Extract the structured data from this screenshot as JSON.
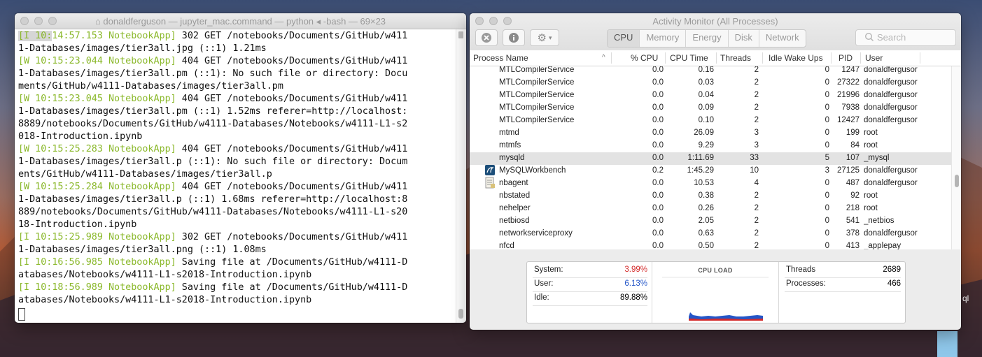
{
  "terminal": {
    "title": "donaldferguson — jupyter_mac.command — python ◂ -bash — 69×23",
    "lines": [
      {
        "tag": "[I 10:14:57.153 NotebookApp]",
        "text": " 302 GET /notebooks/Documents/GitHub/w411"
      },
      {
        "tag": "",
        "text": "1-Databases/images/tier3all.jpg (::1) 1.21ms"
      },
      {
        "tag": "[W 10:15:23.044 NotebookApp]",
        "text": " 404 GET /notebooks/Documents/GitHub/w411"
      },
      {
        "tag": "",
        "text": "1-Databases/images/tier3all.pm (::1): No such file or directory: Docu"
      },
      {
        "tag": "",
        "text": "ments/GitHub/w4111-Databases/images/tier3all.pm"
      },
      {
        "tag": "[W 10:15:23.045 NotebookApp]",
        "text": " 404 GET /notebooks/Documents/GitHub/w411"
      },
      {
        "tag": "",
        "text": "1-Databases/images/tier3all.pm (::1) 1.52ms referer=http://localhost:"
      },
      {
        "tag": "",
        "text": "8889/notebooks/Documents/GitHub/w4111-Databases/Notebooks/w4111-L1-s2"
      },
      {
        "tag": "",
        "text": "018-Introduction.ipynb"
      },
      {
        "tag": "[W 10:15:25.283 NotebookApp]",
        "text": " 404 GET /notebooks/Documents/GitHub/w411"
      },
      {
        "tag": "",
        "text": "1-Databases/images/tier3all.p (::1): No such file or directory: Docum"
      },
      {
        "tag": "",
        "text": "ents/GitHub/w4111-Databases/images/tier3all.p"
      },
      {
        "tag": "[W 10:15:25.284 NotebookApp]",
        "text": " 404 GET /notebooks/Documents/GitHub/w411"
      },
      {
        "tag": "",
        "text": "1-Databases/images/tier3all.p (::1) 1.68ms referer=http://localhost:8"
      },
      {
        "tag": "",
        "text": "889/notebooks/Documents/GitHub/w4111-Databases/Notebooks/w4111-L1-s20"
      },
      {
        "tag": "",
        "text": "18-Introduction.ipynb"
      },
      {
        "tag": "[I 10:15:25.989 NotebookApp]",
        "text": " 302 GET /notebooks/Documents/GitHub/w411"
      },
      {
        "tag": "",
        "text": "1-Databases/images/tier3all.png (::1) 1.08ms"
      },
      {
        "tag": "[I 10:16:56.985 NotebookApp]",
        "text": " Saving file at /Documents/GitHub/w4111-D"
      },
      {
        "tag": "",
        "text": "atabases/Notebooks/w4111-L1-s2018-Introduction.ipynb"
      },
      {
        "tag": "[I 10:18:56.989 NotebookApp]",
        "text": " Saving file at /Documents/GitHub/w4111-D"
      },
      {
        "tag": "",
        "text": "atabases/Notebooks/w4111-L1-s2018-Introduction.ipynb"
      }
    ]
  },
  "activity_monitor": {
    "title": "Activity Monitor (All Processes)",
    "tabs": [
      "CPU",
      "Memory",
      "Energy",
      "Disk",
      "Network"
    ],
    "active_tab": "CPU",
    "search_placeholder": "Search",
    "columns": {
      "name": "Process Name",
      "cpu": "% CPU",
      "time": "CPU Time",
      "threads": "Threads",
      "idle": "Idle Wake Ups",
      "pid": "PID",
      "user": "User"
    },
    "processes": [
      {
        "name": "MTLCompilerService",
        "cpu": "0.0",
        "time": "0.16",
        "threads": "2",
        "idle": "0",
        "pid": "1247",
        "user": "donaldfergusor",
        "icon": ""
      },
      {
        "name": "MTLCompilerService",
        "cpu": "0.0",
        "time": "0.03",
        "threads": "2",
        "idle": "0",
        "pid": "27322",
        "user": "donaldfergusor",
        "icon": ""
      },
      {
        "name": "MTLCompilerService",
        "cpu": "0.0",
        "time": "0.04",
        "threads": "2",
        "idle": "0",
        "pid": "21996",
        "user": "donaldfergusor",
        "icon": ""
      },
      {
        "name": "MTLCompilerService",
        "cpu": "0.0",
        "time": "0.09",
        "threads": "2",
        "idle": "0",
        "pid": "7938",
        "user": "donaldfergusor",
        "icon": ""
      },
      {
        "name": "MTLCompilerService",
        "cpu": "0.0",
        "time": "0.10",
        "threads": "2",
        "idle": "0",
        "pid": "12427",
        "user": "donaldfergusor",
        "icon": ""
      },
      {
        "name": "mtmd",
        "cpu": "0.0",
        "time": "26.09",
        "threads": "3",
        "idle": "0",
        "pid": "199",
        "user": "root",
        "icon": ""
      },
      {
        "name": "mtmfs",
        "cpu": "0.0",
        "time": "9.29",
        "threads": "3",
        "idle": "0",
        "pid": "84",
        "user": "root",
        "icon": ""
      },
      {
        "name": "mysqld",
        "cpu": "0.0",
        "time": "1:11.69",
        "threads": "33",
        "idle": "5",
        "pid": "107",
        "user": "_mysql",
        "icon": ""
      },
      {
        "name": "MySQLWorkbench",
        "cpu": "0.2",
        "time": "1:45.29",
        "threads": "10",
        "idle": "3",
        "pid": "27125",
        "user": "donaldfergusor",
        "icon": "dolphin-icon"
      },
      {
        "name": "nbagent",
        "cpu": "0.0",
        "time": "10.53",
        "threads": "4",
        "idle": "0",
        "pid": "487",
        "user": "donaldfergusor",
        "icon": "document-icon"
      },
      {
        "name": "nbstated",
        "cpu": "0.0",
        "time": "0.38",
        "threads": "2",
        "idle": "0",
        "pid": "92",
        "user": "root",
        "icon": ""
      },
      {
        "name": "nehelper",
        "cpu": "0.0",
        "time": "0.26",
        "threads": "2",
        "idle": "0",
        "pid": "218",
        "user": "root",
        "icon": ""
      },
      {
        "name": "netbiosd",
        "cpu": "0.0",
        "time": "2.05",
        "threads": "2",
        "idle": "0",
        "pid": "541",
        "user": "_netbios",
        "icon": ""
      },
      {
        "name": "networkserviceproxy",
        "cpu": "0.0",
        "time": "0.63",
        "threads": "2",
        "idle": "0",
        "pid": "378",
        "user": "donaldfergusor",
        "icon": ""
      },
      {
        "name": "nfcd",
        "cpu": "0.0",
        "time": "0.50",
        "threads": "2",
        "idle": "0",
        "pid": "413",
        "user": "_applepay",
        "icon": ""
      }
    ],
    "selected_row": 7,
    "stats": {
      "system_label": "System:",
      "system_value": "3.99%",
      "user_label": "User:",
      "user_value": "6.13%",
      "idle_label": "Idle:",
      "idle_value": "89.88%",
      "cpu_load_label": "CPU LOAD",
      "threads_label": "Threads",
      "threads_value": "2689",
      "processes_label": "Processes:",
      "processes_value": "466"
    },
    "colors": {
      "system": "#d42b2b",
      "user": "#2456c8"
    }
  },
  "desktop": {
    "side_text": "ql"
  }
}
